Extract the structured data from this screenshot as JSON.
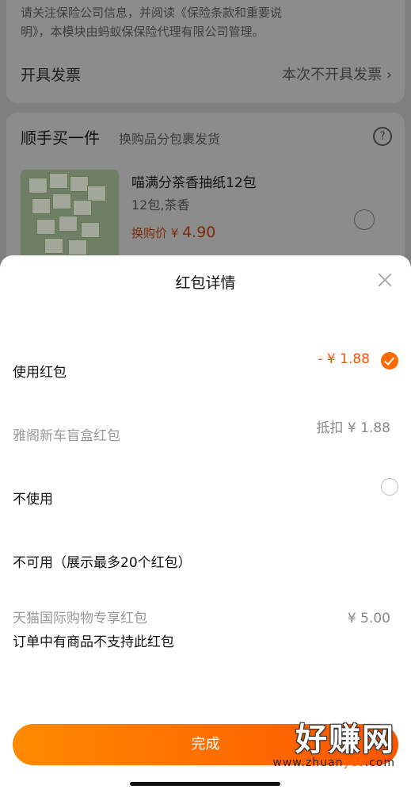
{
  "background": {
    "notice_line1": "请关注保险公司信息，并阅读《保险条款和重要说",
    "notice_line2": "明》，本模块由蚂蚁保保险代理有限公司管理。",
    "invoice_label": "开具发票",
    "invoice_value": "本次不开具发票 ›",
    "addon_title": "顺手买一件",
    "addon_subtitle": "换购品分包裹发货",
    "addon_help_icon": "?",
    "product_name": "喵满分茶香抽纸12包",
    "product_spec": "12包,茶香",
    "product_price_label": "换购价 ¥ ",
    "product_price_value": "4.90"
  },
  "sheet": {
    "title": "红包详情",
    "use_label": "使用红包",
    "use_amount": "- ¥ 1.88",
    "item_name": "雅阁新车盲盒红包",
    "item_deduct": "抵扣 ¥ 1.88",
    "not_use_label": "不使用",
    "unavailable_label": "不可用（展示最多20个红包）",
    "unavail_item_name": "天猫国际购物专享红包",
    "unavail_item_amount": "¥ 5.00",
    "unavail_reason": "订单中有商品不支持此红包",
    "done_button": "完成"
  },
  "watermark": {
    "text": "好赚网",
    "url_prefix": "www.zhuan",
    "url_highlight": "yes",
    "url_suffix": ".com"
  },
  "colors": {
    "accent": "#ff5000",
    "button_gradient_start": "#ff8a00",
    "button_gradient_end": "#ff5500"
  }
}
